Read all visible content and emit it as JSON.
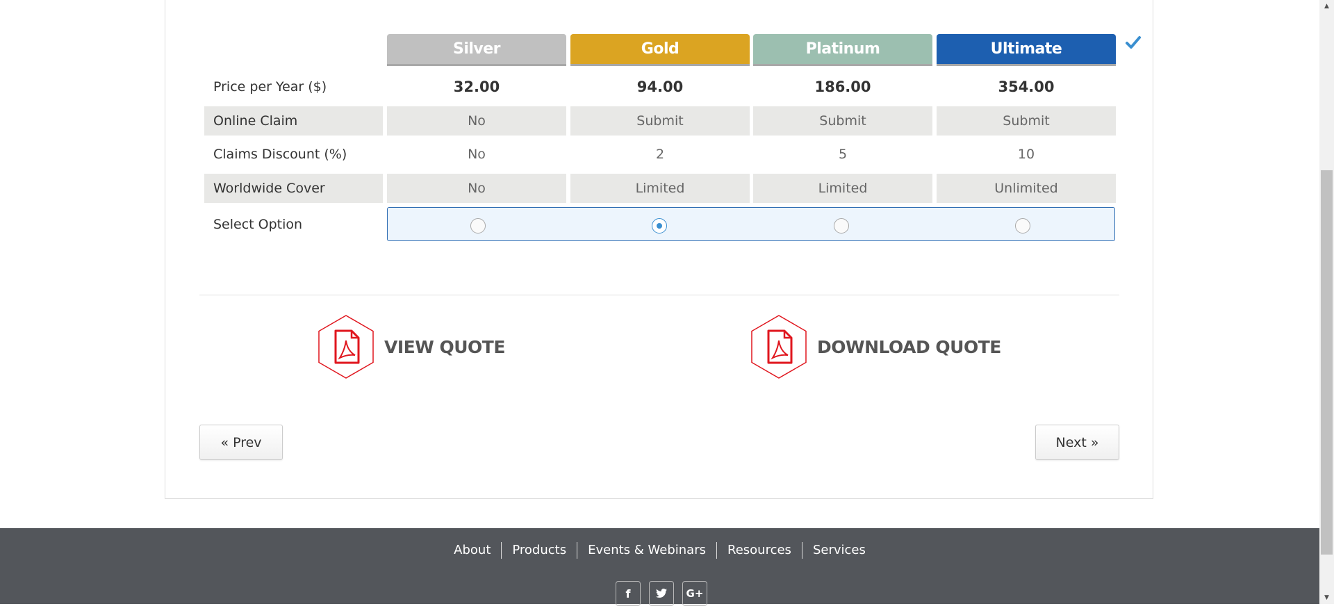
{
  "plans": [
    {
      "name": "Silver",
      "color": "#c0c0c0",
      "price": "32.00",
      "online_claim": "No",
      "claims_discount": "No",
      "worldwide_cover": "No",
      "selected": false
    },
    {
      "name": "Gold",
      "color": "#dba422",
      "price": "94.00",
      "online_claim": "Submit",
      "claims_discount": "2",
      "worldwide_cover": "Limited",
      "selected": true
    },
    {
      "name": "Platinum",
      "color": "#9cbfb0",
      "price": "186.00",
      "online_claim": "Submit",
      "claims_discount": "5",
      "worldwide_cover": "Limited",
      "selected": false
    },
    {
      "name": "Ultimate",
      "color": "#1d5fb0",
      "price": "354.00",
      "online_claim": "Submit",
      "claims_discount": "10",
      "worldwide_cover": "Unlimited",
      "selected": false
    }
  ],
  "row_labels": {
    "price": "Price per Year ($)",
    "online_claim": "Online Claim",
    "claims_discount": "Claims Discount (%)",
    "worldwide_cover": "Worldwide Cover",
    "select_option": "Select Option"
  },
  "quotes": {
    "view_label": "VIEW QUOTE",
    "download_label": "DOWNLOAD QUOTE"
  },
  "navigation": {
    "prev_label": "« Prev",
    "next_label": "Next »"
  },
  "footer": {
    "links": [
      "About",
      "Products",
      "Events & Webinars",
      "Resources",
      "Services"
    ],
    "social": [
      "facebook-icon",
      "twitter-icon",
      "google-plus-icon"
    ]
  },
  "colors": {
    "accent": "#3a8fd0",
    "pdf_icon": "#e0161e",
    "footer_bg": "#53565b"
  }
}
